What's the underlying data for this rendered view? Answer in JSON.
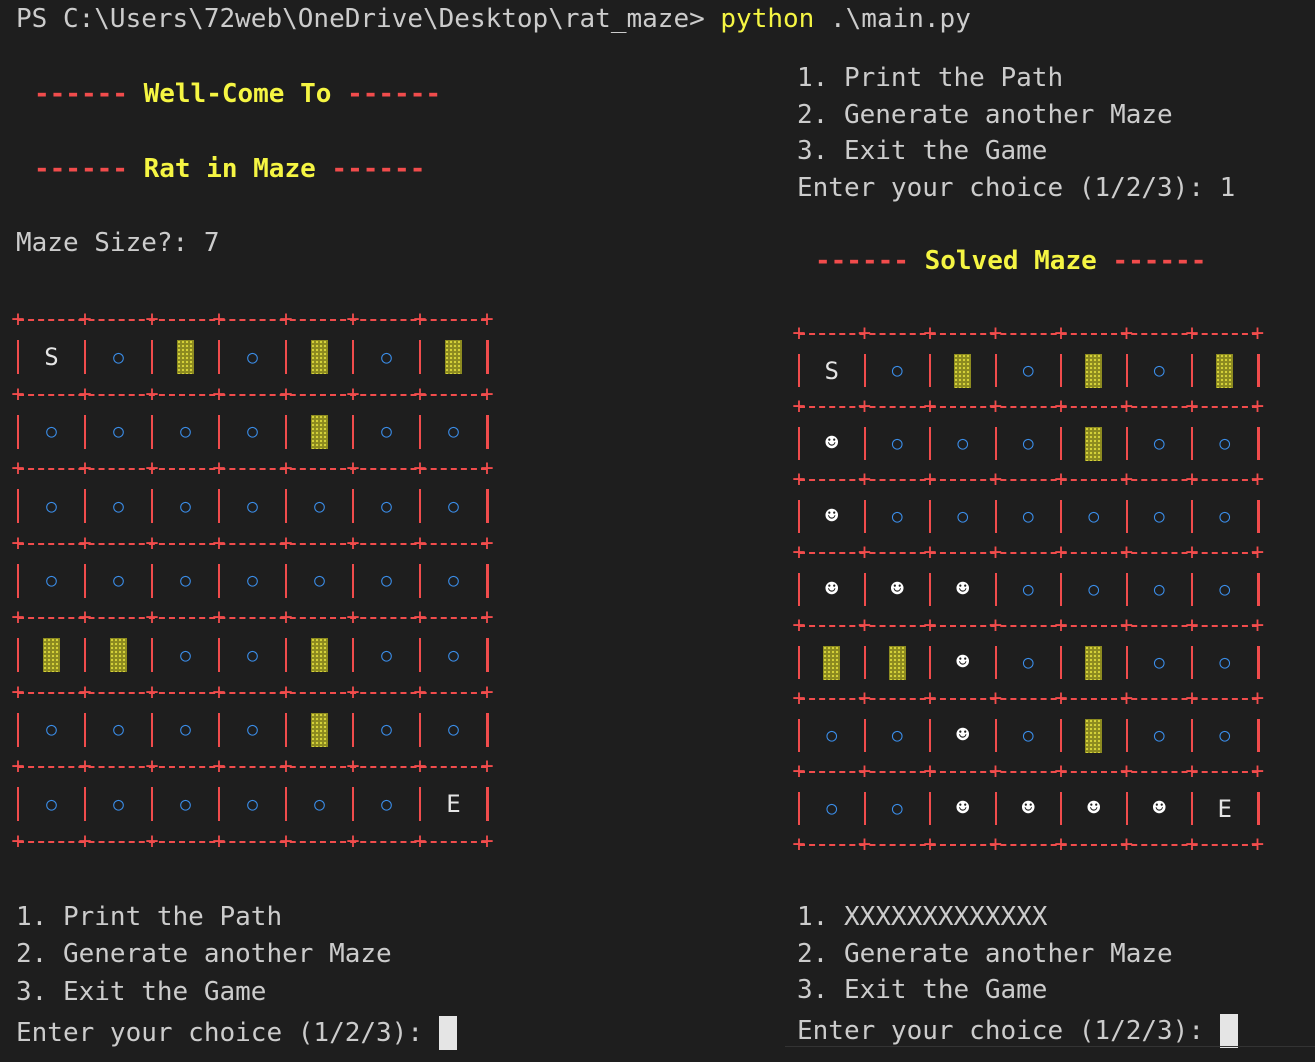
{
  "prompt": {
    "ps": "PS C:\\Users\\72web\\OneDrive\\Desktop\\rat_maze> ",
    "command": "python",
    "args": " .\\main.py"
  },
  "left": {
    "dashes": "------",
    "welcome": "Well-Come To",
    "title": "Rat in Maze",
    "size_prompt": "Maze Size?: 7",
    "menu": [
      "1. Print the Path",
      "2. Generate another Maze",
      "3. Exit the Game"
    ],
    "choice_prompt": "Enter your choice (1/2/3): ",
    "maze": [
      [
        "S",
        "o",
        "#",
        "o",
        "#",
        "o",
        "#"
      ],
      [
        "o",
        "o",
        "o",
        "o",
        "#",
        "o",
        "o"
      ],
      [
        "o",
        "o",
        "o",
        "o",
        "o",
        "o",
        "o"
      ],
      [
        "o",
        "o",
        "o",
        "o",
        "o",
        "o",
        "o"
      ],
      [
        "#",
        "#",
        "o",
        "o",
        "#",
        "o",
        "o"
      ],
      [
        "o",
        "o",
        "o",
        "o",
        "#",
        "o",
        "o"
      ],
      [
        "o",
        "o",
        "o",
        "o",
        "o",
        "o",
        "E"
      ]
    ]
  },
  "right": {
    "menu_top": [
      "1. Print the Path",
      "2. Generate another Maze",
      "3. Exit the Game"
    ],
    "choice_prompt_top": "Enter your choice (1/2/3): 1",
    "dashes": "------",
    "solved_title": "Solved Maze",
    "maze": [
      [
        "S",
        "o",
        "#",
        "o",
        "#",
        "o",
        "#"
      ],
      [
        "@",
        "o",
        "o",
        "o",
        "#",
        "o",
        "o"
      ],
      [
        "@",
        "o",
        "o",
        "o",
        "o",
        "o",
        "o"
      ],
      [
        "@",
        "@",
        "@",
        "o",
        "o",
        "o",
        "o"
      ],
      [
        "#",
        "#",
        "@",
        "o",
        "#",
        "o",
        "o"
      ],
      [
        "o",
        "o",
        "@",
        "o",
        "#",
        "o",
        "o"
      ],
      [
        "o",
        "o",
        "@",
        "@",
        "@",
        "@",
        "E"
      ]
    ],
    "menu_bottom": [
      "1. XXXXXXXXXXXXX",
      "2. Generate another Maze",
      "3. Exit the Game"
    ],
    "choice_prompt_bottom": "Enter your choice (1/2/3): "
  },
  "symbols": {
    "open": "○",
    "path": "☻"
  },
  "colors": {
    "background": "#1e1e1e",
    "text": "#cccccc",
    "yellow": "#f5f543",
    "red_border": "#f14c4c",
    "open_blue": "#3b8eea",
    "block": "#8c8a20"
  }
}
